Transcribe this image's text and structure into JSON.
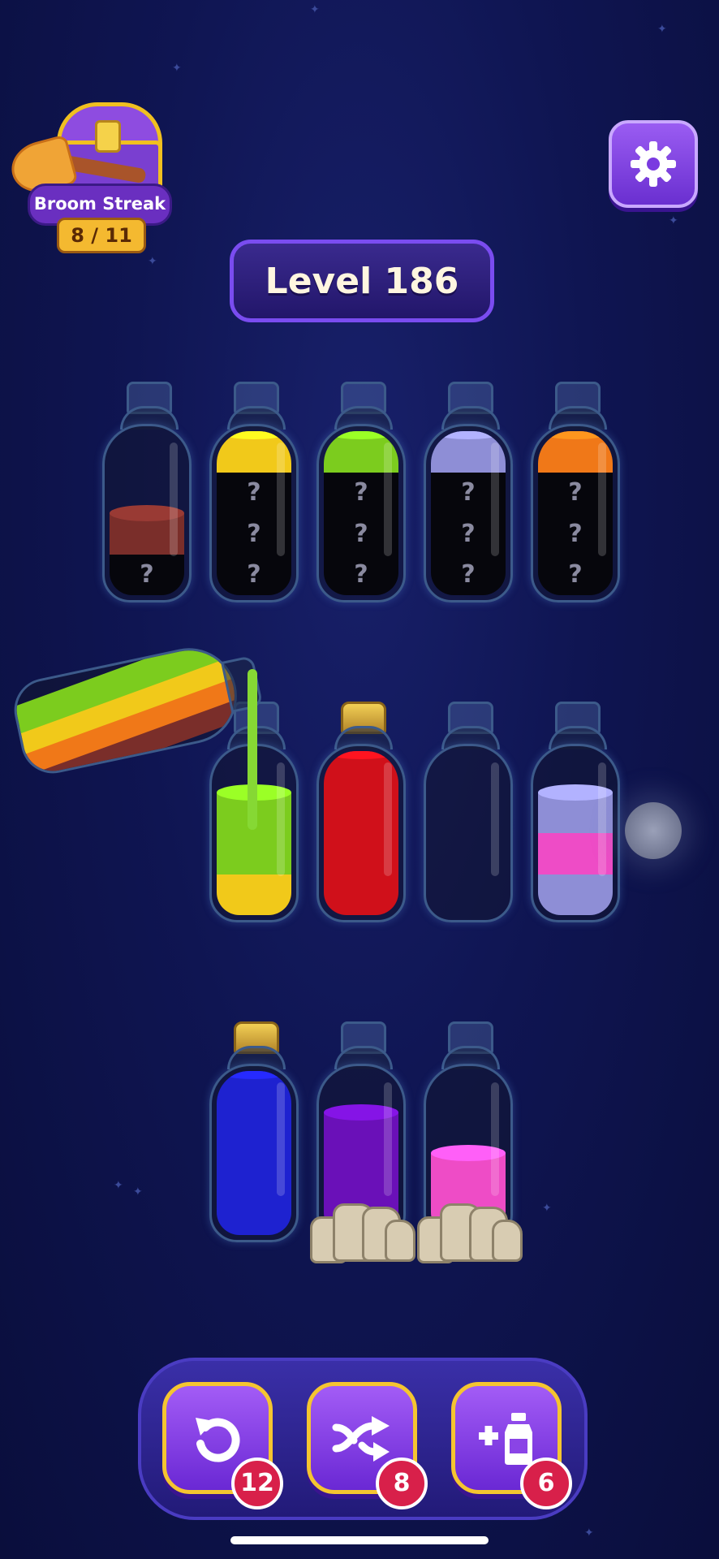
{
  "streak": {
    "label": "Broom Streak",
    "count": "8 / 11"
  },
  "settings": {
    "icon": "gear-icon"
  },
  "level": {
    "label": "Level 186"
  },
  "colors": {
    "yellow": "#f1c91a",
    "green": "#7ccc1e",
    "lavender": "#8e8ed6",
    "orange": "#f07818",
    "brown": "#7a2e2a",
    "red": "#d0101a",
    "blue": "#1e22d0",
    "purple": "#6a10b8",
    "pink": "#ee4cc6",
    "hidden": "#06060c"
  },
  "rows": [
    {
      "bottles": [
        {
          "segments": [
            "hidden",
            "brown"
          ],
          "cork": false,
          "rocks": false
        },
        {
          "segments": [
            "hidden",
            "hidden",
            "hidden",
            "yellow"
          ],
          "cork": false,
          "rocks": false
        },
        {
          "segments": [
            "hidden",
            "hidden",
            "hidden",
            "green"
          ],
          "cork": false,
          "rocks": false
        },
        {
          "segments": [
            "hidden",
            "hidden",
            "hidden",
            "lavender"
          ],
          "cork": false,
          "rocks": false
        },
        {
          "segments": [
            "hidden",
            "hidden",
            "hidden",
            "orange"
          ],
          "cork": false,
          "rocks": false
        }
      ]
    },
    {
      "bottles": [
        {
          "segments": [
            "yellow",
            "green",
            "green"
          ],
          "cork": false,
          "rocks": false
        },
        {
          "segments": [
            "red",
            "red",
            "red",
            "red"
          ],
          "cork": true,
          "rocks": false
        },
        {
          "segments": [],
          "cork": false,
          "rocks": false
        },
        {
          "segments": [
            "lavender",
            "pink",
            "lavender"
          ],
          "cork": false,
          "rocks": false
        }
      ]
    },
    {
      "bottles": [
        {
          "segments": [
            "blue",
            "blue",
            "blue",
            "blue"
          ],
          "cork": true,
          "rocks": false
        },
        {
          "segments": [
            "purple",
            "purple",
            "purple"
          ],
          "cork": false,
          "rocks": true
        },
        {
          "segments": [
            "pink",
            "pink"
          ],
          "cork": false,
          "rocks": true
        }
      ]
    }
  ],
  "pouring_bottle": {
    "segments": [
      "brown",
      "orange",
      "yellow",
      "green"
    ]
  },
  "toolbar": [
    {
      "name": "undo-button",
      "icon": "undo-icon",
      "count": "12"
    },
    {
      "name": "shuffle-button",
      "icon": "shuffle-icon",
      "count": "8"
    },
    {
      "name": "add-bottle-button",
      "icon": "add-bottle-icon",
      "count": "6"
    }
  ]
}
